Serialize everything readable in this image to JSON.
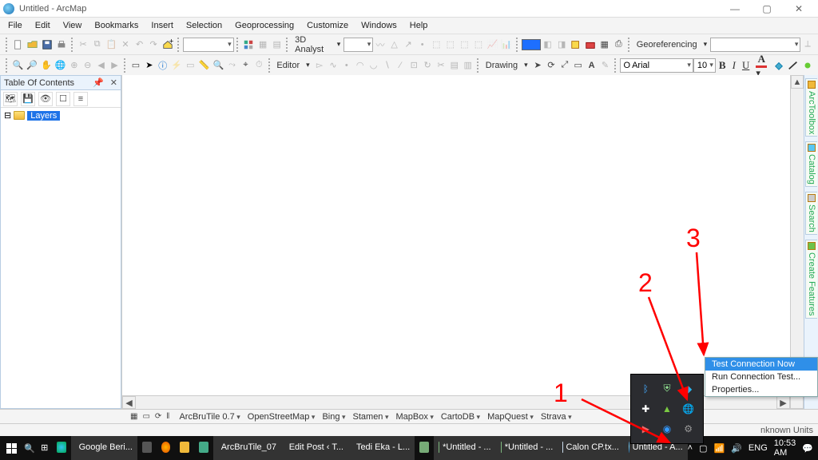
{
  "window": {
    "title": "Untitled - ArcMap"
  },
  "menus": [
    "File",
    "Edit",
    "View",
    "Bookmarks",
    "Insert",
    "Selection",
    "Geoprocessing",
    "Customize",
    "Windows",
    "Help"
  ],
  "toolbar1": {
    "analyst_label": "3D Analyst",
    "georef_label": "Georeferencing"
  },
  "toolbar2": {
    "editor_label": "Editor",
    "drawing_label": "Drawing",
    "font_name": "Arial",
    "font_size": "10"
  },
  "toc": {
    "title": "Table Of Contents",
    "root": "Layers"
  },
  "side_tabs": [
    "ArcToolbox",
    "Catalog",
    "Search",
    "Create Features"
  ],
  "brutile": [
    "ArcBruTile 0.7",
    "OpenStreetMap",
    "Bing",
    "Stamen",
    "MapBox",
    "CartoDB",
    "MapQuest",
    "Strava"
  ],
  "viewbar": {
    "label": ""
  },
  "status": {
    "units": "nknown Units"
  },
  "context_menu": {
    "item1": "Test Connection Now",
    "item2": "Run Connection Test...",
    "item3": "Properties..."
  },
  "annotations": {
    "n1": "1",
    "n2": "2",
    "n3": "3"
  },
  "taskbar": {
    "items": [
      {
        "label": "Google Beri..."
      },
      {
        "label": ""
      },
      {
        "label": ""
      },
      {
        "label": ""
      },
      {
        "label": ""
      },
      {
        "label": "ArcBruTile_07"
      },
      {
        "label": "Edit Post ‹ T..."
      },
      {
        "label": "Tedi Eka - L..."
      },
      {
        "label": ""
      },
      {
        "label": "*Untitled - ..."
      },
      {
        "label": "*Untitled - ..."
      },
      {
        "label": "Calon CP.tx..."
      },
      {
        "label": "Untitled - A..."
      }
    ],
    "lang": "ENG",
    "time": "10:53 AM",
    "notif": ""
  }
}
